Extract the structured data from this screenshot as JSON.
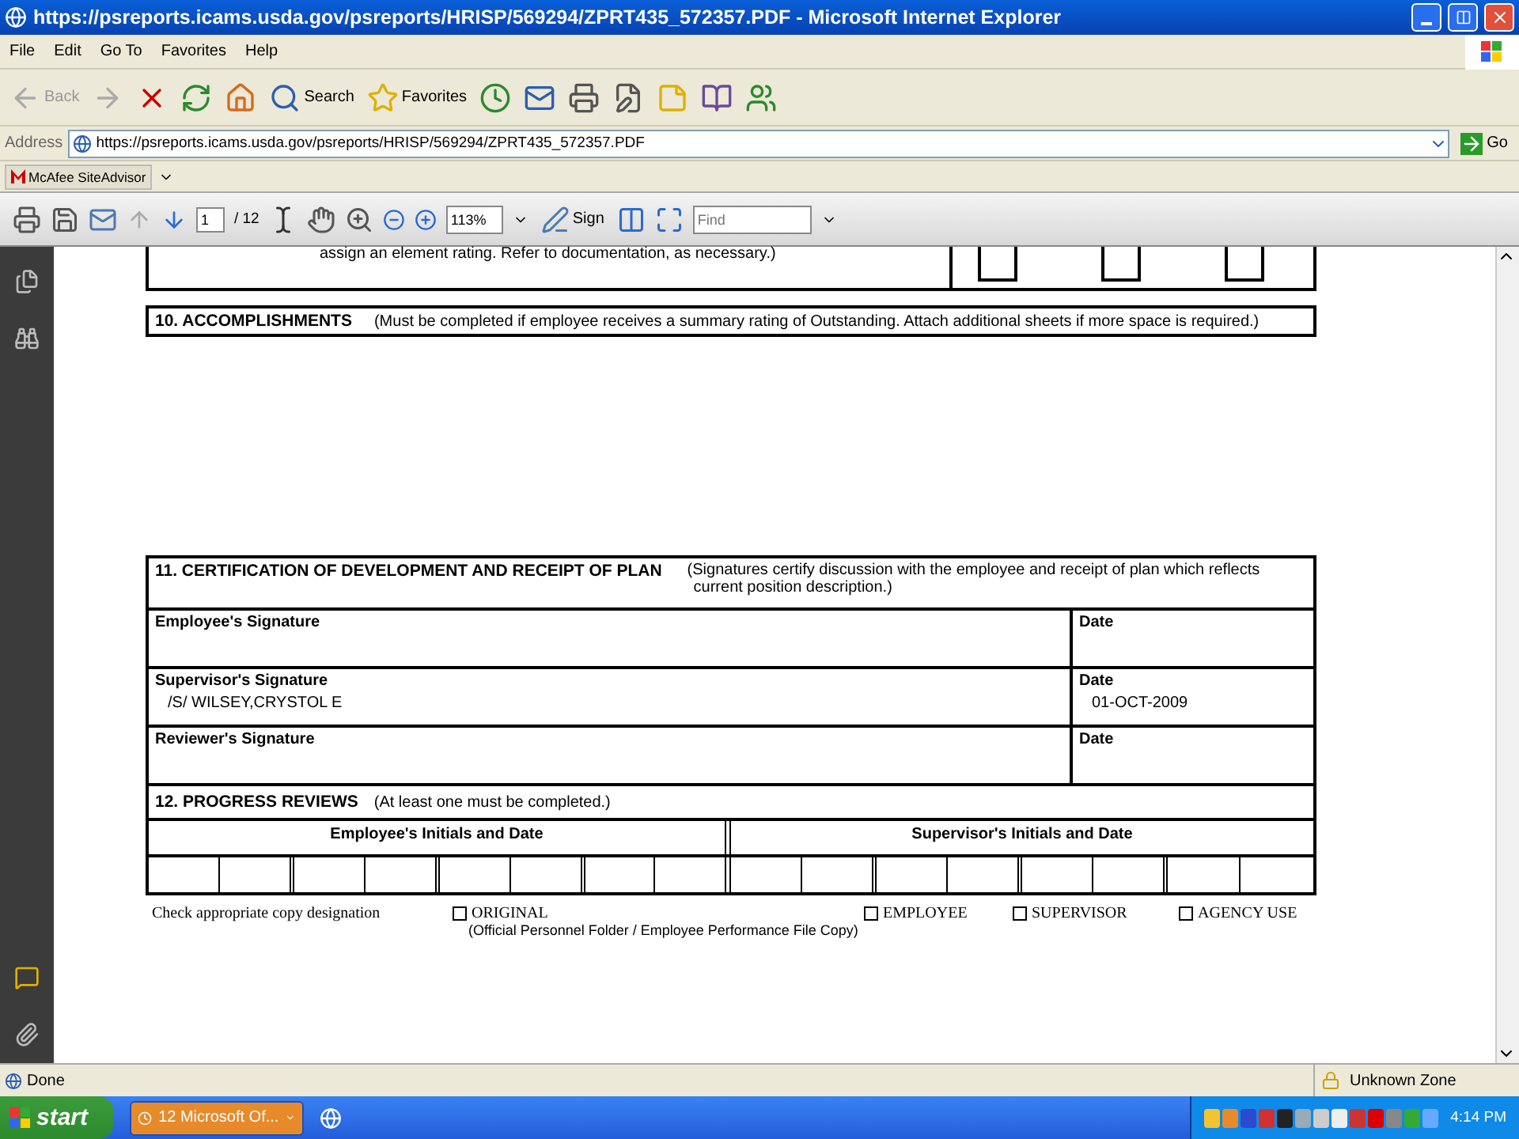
{
  "window": {
    "title": "https://psreports.icams.usda.gov/psreports/HRISP/569294/ZPRT435_572357.PDF - Microsoft Internet Explorer"
  },
  "menu": [
    "File",
    "Edit",
    "Go To",
    "Favorites",
    "Help"
  ],
  "toolbar": [
    {
      "kind": "back",
      "label": "Back",
      "disabled": true
    },
    {
      "kind": "forward",
      "disabled": true
    },
    {
      "kind": "stop"
    },
    {
      "kind": "refresh"
    },
    {
      "kind": "home"
    },
    {
      "kind": "search",
      "label": "Search"
    },
    {
      "kind": "favorites",
      "label": "Favorites"
    },
    {
      "kind": "history"
    },
    {
      "kind": "mail"
    },
    {
      "kind": "print"
    },
    {
      "kind": "edit"
    },
    {
      "kind": "notes"
    },
    {
      "kind": "research"
    },
    {
      "kind": "messenger"
    }
  ],
  "address": {
    "label": "Address",
    "value": "https://psreports.icams.usda.gov/psreports/HRISP/569294/ZPRT435_572357.PDF",
    "go": "Go"
  },
  "links_bar": {
    "button": "McAfee SiteAdvisor"
  },
  "pdf_toolbar": {
    "page": "1",
    "page_count": "/ 12",
    "zoom": "113%",
    "sign": "Sign",
    "find_placeholder": "Find"
  },
  "document": {
    "partial_row": {
      "text": "assign an element rating.  Refer to documentation, as necessary.)"
    },
    "section10": {
      "title": "10. ACCOMPLISHMENTS",
      "note": "(Must be completed if employee receives a summary rating of Outstanding.  Attach additional sheets if more space is required.)"
    },
    "section11": {
      "title": "11. CERTIFICATION OF DEVELOPMENT AND RECEIPT OF PLAN",
      "note": "(Signatures certify discussion with the employee and receipt of plan which reflects current position description.)",
      "rows": [
        {
          "label": "Employee's Signature",
          "date_label": "Date"
        },
        {
          "label": "Supervisor's Signature",
          "value": "/S/ WILSEY,CRYSTOL E",
          "date_label": "Date",
          "date": "01-OCT-2009"
        },
        {
          "label": "Reviewer's Signature",
          "date_label": "Date"
        }
      ]
    },
    "section12": {
      "title": "12. PROGRESS REVIEWS",
      "note": "(At least one must be completed.)",
      "columns": [
        "Employee's Initials and Date",
        "Supervisor's Initials and Date"
      ]
    },
    "copy_designation": {
      "label": "Check appropriate copy designation",
      "options": [
        {
          "label": "ORIGINAL",
          "checked": false,
          "note": "(Official Personnel Folder / Employee Performance File Copy)"
        },
        {
          "label": "EMPLOYEE",
          "checked": false
        },
        {
          "label": "SUPERVISOR",
          "checked": false
        },
        {
          "label": "AGENCY USE",
          "checked": false
        }
      ]
    }
  },
  "status_bar": {
    "text": "Done",
    "zone": "Unknown Zone"
  },
  "taskbar": {
    "start": "start",
    "tasks": [
      {
        "label": "12 Microsoft Of...",
        "selected": true
      }
    ],
    "clock": "4:14 PM"
  }
}
